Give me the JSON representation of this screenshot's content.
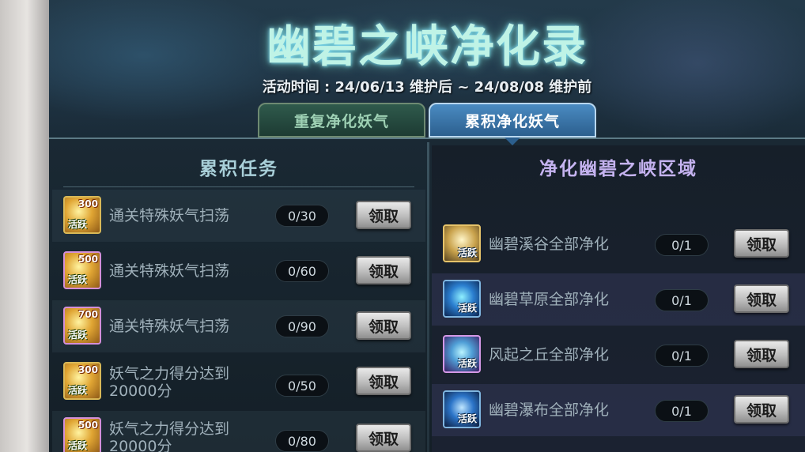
{
  "header": {
    "title": "幽碧之峡净化录",
    "date_range": "活动时间 : 24/06/13 维护后 ~ 24/08/08 维护前"
  },
  "tabs": [
    {
      "label": "重复净化妖气",
      "active": false
    },
    {
      "label": "累积净化妖气",
      "active": true
    }
  ],
  "left_panel": {
    "title": "累积任务",
    "tasks": [
      {
        "reward_amount": "300",
        "reward_tag": "活跃",
        "label": "通关特殊妖气扫荡",
        "progress": "0/30",
        "button": "领取"
      },
      {
        "reward_amount": "500",
        "reward_tag": "活跃",
        "label": "通关特殊妖气扫荡",
        "progress": "0/60",
        "button": "领取"
      },
      {
        "reward_amount": "700",
        "reward_tag": "活跃",
        "label": "通关特殊妖气扫荡",
        "progress": "0/90",
        "button": "领取"
      },
      {
        "reward_amount": "300",
        "reward_tag": "活跃",
        "label_line1": "妖气之力得分达到",
        "label_line2": "20000分",
        "progress": "0/50",
        "button": "领取"
      },
      {
        "reward_amount": "500",
        "reward_tag": "活跃",
        "label_line1": "妖气之力得分达到",
        "label_line2": "20000分",
        "progress": "0/80",
        "button": "领取"
      }
    ]
  },
  "right_panel": {
    "title": "净化幽碧之峡区域",
    "areas": [
      {
        "reward_tag": "活跃",
        "label": "幽碧溪谷全部净化",
        "progress": "0/1",
        "button": "领取"
      },
      {
        "reward_tag": "活跃",
        "label": "幽碧草原全部净化",
        "progress": "0/1",
        "button": "领取"
      },
      {
        "reward_tag": "活跃",
        "label": "风起之丘全部净化",
        "progress": "0/1",
        "button": "领取"
      },
      {
        "reward_tag": "活跃",
        "label": "幽碧瀑布全部净化",
        "progress": "0/1",
        "button": "领取"
      }
    ]
  }
}
